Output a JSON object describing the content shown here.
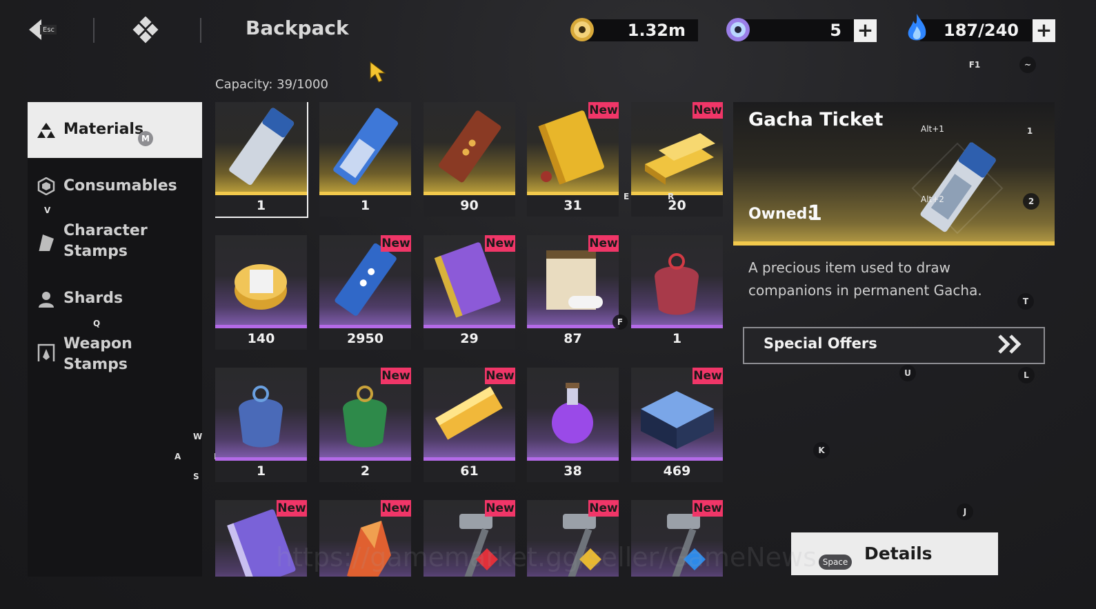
{
  "header": {
    "esc_label": "Esc",
    "title": "Backpack",
    "currency_gold": "1.32m",
    "currency_gem": "5",
    "currency_energy": "187/240",
    "key_f1": "F1",
    "key_tilde": "~"
  },
  "capacity": "Capacity: 39/1000",
  "sidebar": {
    "items": [
      {
        "label": "Materials",
        "hotkey": "M",
        "icon": "materials-icon"
      },
      {
        "label": "Consumables",
        "icon": "consumables-icon"
      },
      {
        "label": "Character Stamps",
        "icon": "character-stamp-icon"
      },
      {
        "label": "Shards",
        "icon": "shards-icon"
      },
      {
        "label": "Weapon Stamps",
        "icon": "weapon-stamp-icon"
      }
    ],
    "key_v": "V",
    "key_q": "Q"
  },
  "grid": {
    "new_label": "New",
    "items": [
      {
        "count": "1",
        "rarity": "gold",
        "icon": "gacha-ticket-silver"
      },
      {
        "count": "1",
        "rarity": "gold",
        "icon": "gacha-ticket-blue"
      },
      {
        "count": "90",
        "rarity": "gold",
        "icon": "red-ticket"
      },
      {
        "count": "31",
        "rarity": "gold",
        "icon": "golden-book"
      },
      {
        "count": "20",
        "rarity": "gold",
        "icon": "gold-bars"
      },
      {
        "count": "140",
        "rarity": "purple",
        "icon": "coin-stack"
      },
      {
        "count": "2950",
        "rarity": "purple",
        "icon": "blue-ticket"
      },
      {
        "count": "29",
        "rarity": "purple",
        "icon": "purple-book"
      },
      {
        "count": "87",
        "rarity": "purple",
        "icon": "scroll-book"
      },
      {
        "count": "1",
        "rarity": "purple",
        "icon": "red-pouch"
      },
      {
        "count": "1",
        "rarity": "purple",
        "icon": "blue-pouch"
      },
      {
        "count": "2",
        "rarity": "purple",
        "icon": "green-pouch"
      },
      {
        "count": "61",
        "rarity": "purple",
        "icon": "gold-ingot"
      },
      {
        "count": "38",
        "rarity": "purple",
        "icon": "potion"
      },
      {
        "count": "469",
        "rarity": "purple",
        "icon": "crystal-box"
      },
      {
        "count": "",
        "rarity": "purple",
        "icon": "purple-book-2"
      },
      {
        "count": "",
        "rarity": "purple",
        "icon": "fire-crystal"
      },
      {
        "count": "",
        "rarity": "purple",
        "icon": "hammer-red"
      },
      {
        "count": "",
        "rarity": "purple",
        "icon": "hammer-gold"
      },
      {
        "count": "",
        "rarity": "purple",
        "icon": "hammer-blue"
      }
    ],
    "key_f": "F",
    "key_w": "W",
    "key_a": "A",
    "key_s": "S",
    "key_d": "D",
    "key_e": "E",
    "key_r": "R"
  },
  "detail": {
    "title": "Gacha Ticket",
    "owned_label": "Owned:",
    "owned_value": "1",
    "description": "A precious item used to draw companions in permanent Gacha.",
    "offers_label": "Special Offers",
    "key_alt1": "Alt+1",
    "key_alt2": "Alt+2",
    "key_1": "1",
    "key_2": "2",
    "key_t": "T",
    "key_u": "U",
    "key_l": "L",
    "key_k": "K",
    "key_j": "J"
  },
  "details_button": {
    "label": "Details",
    "hotkey": "Space"
  },
  "watermark": "https://gamemarket.gg/seller/GameNews",
  "colors": {
    "accent_gold": "#f2c94c",
    "accent_purple": "#b46ae8",
    "new_badge": "#f03668"
  }
}
